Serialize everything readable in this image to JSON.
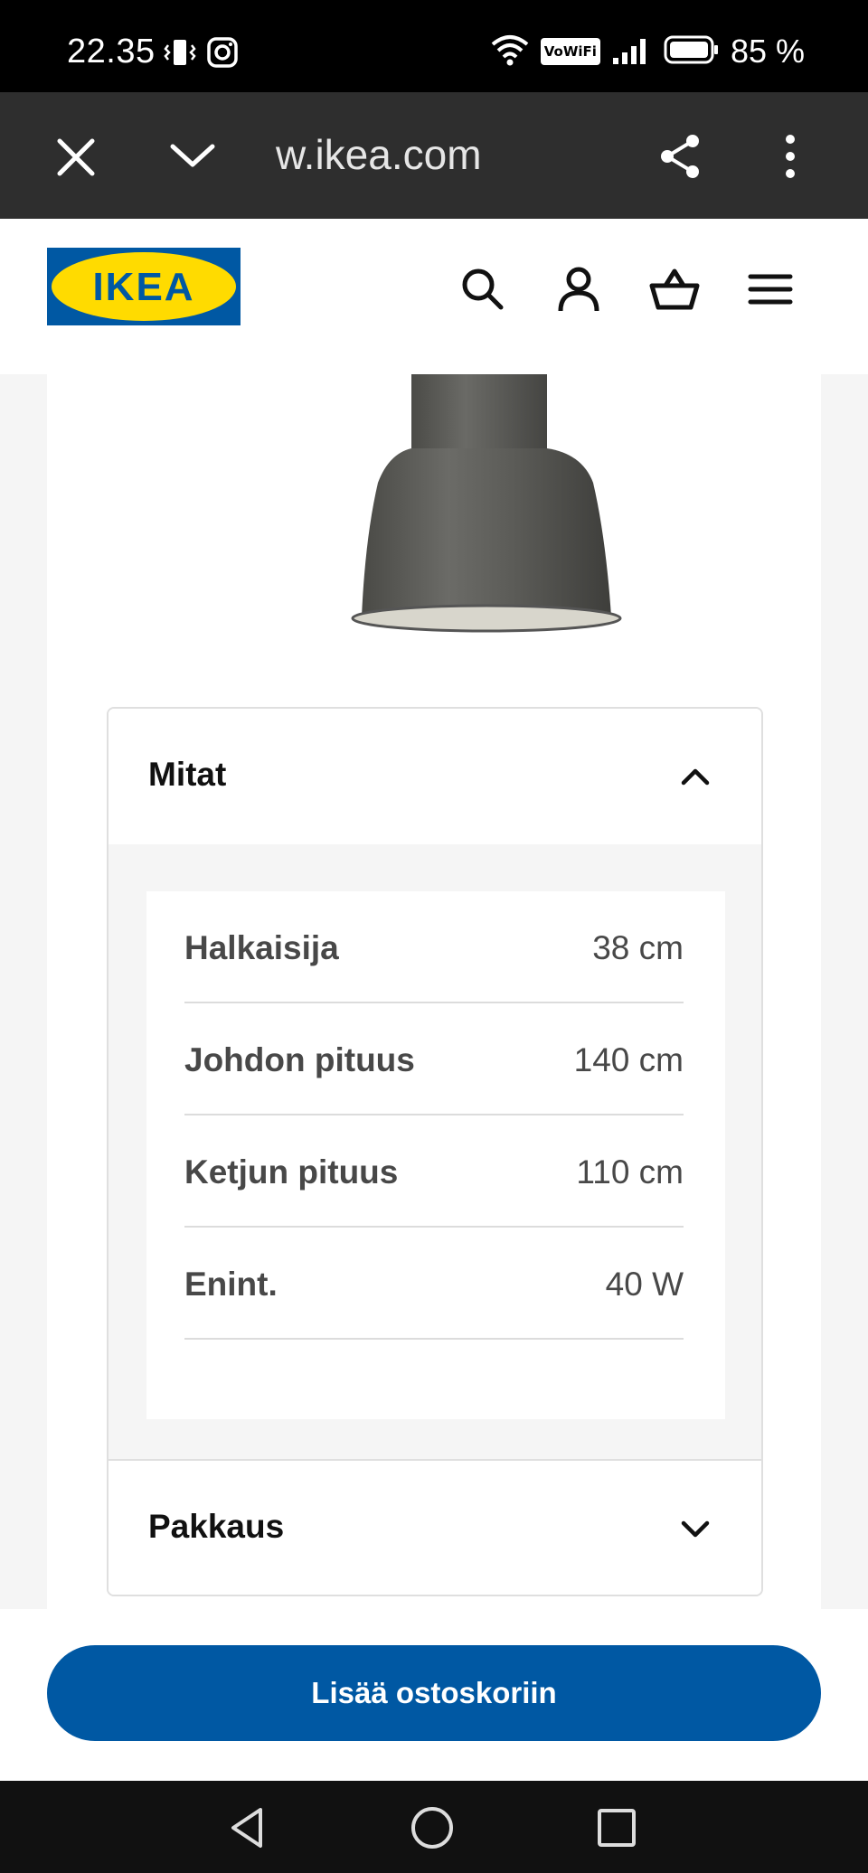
{
  "status_bar": {
    "time": "22.35",
    "vowifi": "VoWiFi",
    "battery_text": "85 %"
  },
  "browser": {
    "url": "w.ikea.com"
  },
  "header": {
    "logo_text": "IKEA",
    "logo_colors": {
      "background": "#0058a3",
      "oval": "#ffdb00",
      "text": "#0058a3"
    }
  },
  "dimensions": {
    "title": "Mitat",
    "rows": [
      {
        "label": "Halkaisija",
        "value": "38 cm"
      },
      {
        "label": "Johdon pituus",
        "value": "140 cm"
      },
      {
        "label": "Ketjun pituus",
        "value": "110 cm"
      },
      {
        "label": "Enint.",
        "value": "40 W"
      }
    ]
  },
  "packaging": {
    "title": "Pakkaus"
  },
  "cta": {
    "label": "Lisää ostoskoriin",
    "color": "#0058a3"
  }
}
